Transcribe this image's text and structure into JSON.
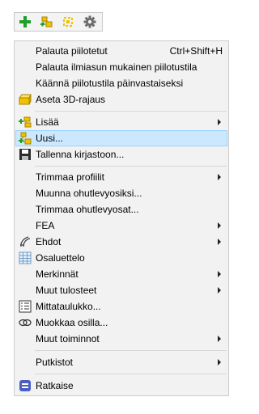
{
  "toolbar": {
    "buttons": [
      {
        "icon": "add-green-plus-icon"
      },
      {
        "icon": "new-assembly-icon"
      },
      {
        "icon": "select-component-icon"
      },
      {
        "icon": "gear-icon"
      }
    ]
  },
  "menu": {
    "items": [
      {
        "label": "Palauta piilotetut",
        "shortcut": "Ctrl+Shift+H"
      },
      {
        "label": "Palauta ilmiasun mukainen piilotustila"
      },
      {
        "label": "Käännä piilotustila päinvastaiseksi"
      },
      {
        "label": "Aseta 3D-rajaus",
        "icon": "3d-clip-box-icon"
      },
      {
        "label": "Lisää",
        "icon": "add-component-icon",
        "submenu": true
      },
      {
        "label": "Uusi...",
        "icon": "new-component-icon",
        "highlighted": true
      },
      {
        "label": "Tallenna kirjastoon...",
        "icon": "save-disk-icon"
      },
      {
        "label": "Trimmaa profiilit",
        "submenu": true
      },
      {
        "label": "Muunna ohutlevyosiksi..."
      },
      {
        "label": "Trimmaa ohutlevyosat..."
      },
      {
        "label": "FEA",
        "submenu": true
      },
      {
        "label": "Ehdot",
        "icon": "constraints-icon",
        "submenu": true
      },
      {
        "label": "Osaluettelo",
        "icon": "parts-list-table-icon"
      },
      {
        "label": "Merkinnät",
        "submenu": true
      },
      {
        "label": "Muut tulosteet",
        "submenu": true
      },
      {
        "label": "Mittataulukko...",
        "icon": "dimension-table-icon"
      },
      {
        "label": "Muokkaa osilla...",
        "icon": "edit-with-parts-icon"
      },
      {
        "label": "Muut toiminnot",
        "submenu": true
      },
      {
        "label": "Putkistot",
        "submenu": true
      },
      {
        "label": "Ratkaise",
        "icon": "solve-icon"
      }
    ]
  }
}
